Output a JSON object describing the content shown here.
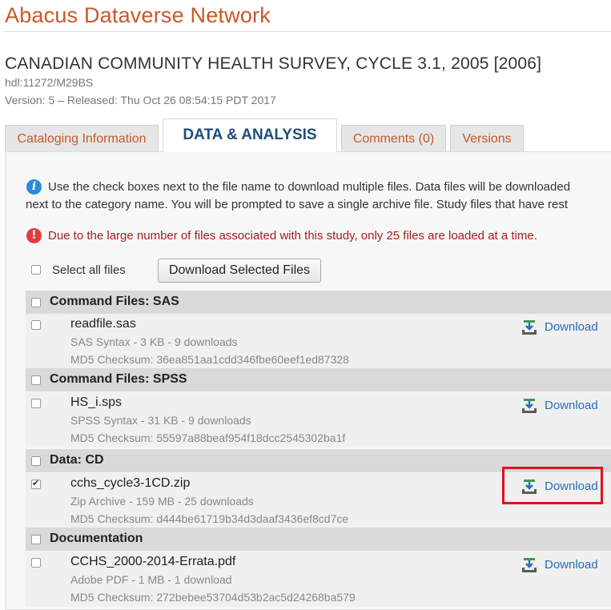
{
  "site": {
    "title": "Abacus Dataverse Network"
  },
  "study": {
    "title": "CANADIAN COMMUNITY HEALTH SURVEY, CYCLE 3.1, 2005 [2006]",
    "handle": "hdl:11272/M29BS",
    "version": "Version: 5 – Released: Thu Oct 26 08:54:15 PDT 2017"
  },
  "tabs": [
    {
      "label": "Cataloging Information",
      "active": false
    },
    {
      "label": "DATA & ANALYSIS",
      "active": true
    },
    {
      "label": "Comments (0)",
      "active": false
    },
    {
      "label": "Versions",
      "active": false
    }
  ],
  "info": {
    "line1": "Use the check boxes next to the file name to download multiple files. Data files will be downloaded",
    "line2": "next to the category name. You will be prompted to save a single archive file. Study files that have rest",
    "icon": "info-icon"
  },
  "warning": {
    "text": "Due to the large number of files associated with this study, only 25 files are loaded at a time.",
    "icon": "exclamation-icon",
    "color": "#a32020"
  },
  "toolbar": {
    "select_all_label": "Select all files",
    "download_selected_label": "Download Selected Files"
  },
  "download_label": "Download",
  "categories": [
    {
      "name": "Command Files: SAS",
      "files": [
        {
          "name": "readfile.sas",
          "meta": "SAS Syntax - 3 KB - 9 downloads",
          "md5": "MD5 Checksum: 36ea851aa1cdd346fbe60eef1ed87328",
          "checked": false
        }
      ]
    },
    {
      "name": "Command Files: SPSS",
      "files": [
        {
          "name": "HS_i.sps",
          "meta": "SPSS Syntax - 31 KB - 9 downloads",
          "md5": "MD5 Checksum: 55597a88beaf954f18dcc2545302ba1f",
          "checked": false
        }
      ]
    },
    {
      "name": "Data: CD",
      "files": [
        {
          "name": "cchs_cycle3-1CD.zip",
          "meta": "Zip Archive - 159 MB - 25 downloads",
          "md5": "MD5 Checksum: d444be61719b34d3daaf3436ef8cd7ce",
          "checked": true
        }
      ]
    },
    {
      "name": "Documentation",
      "files": [
        {
          "name": "CCHS_2000-2014-Errata.pdf",
          "meta": "Adobe PDF - 1 MB - 1 download",
          "md5": "MD5 Checksum: 272bebee53704d53b2ac5d24268ba579",
          "checked": false
        }
      ]
    }
  ],
  "colors": {
    "brand": "#c55a2b",
    "link": "#2a6db5",
    "highlight": "#e0101e"
  }
}
